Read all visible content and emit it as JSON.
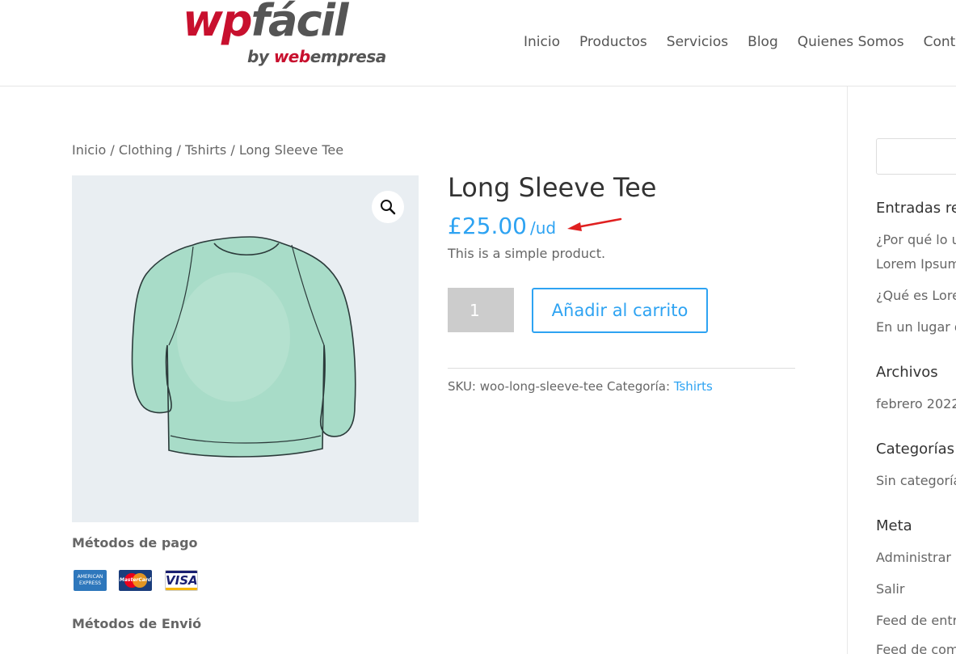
{
  "header": {
    "logo": {
      "main_red": "wp",
      "main_gray": "fácil",
      "by": "by ",
      "web": "web",
      "empresa": "empresa"
    },
    "nav": [
      "Inicio",
      "Productos",
      "Servicios",
      "Blog",
      "Quienes Somos",
      "Contacto"
    ]
  },
  "breadcrumb": {
    "items": [
      "Inicio",
      "Clothing",
      "Tshirts"
    ],
    "separator": " / ",
    "current": "Long Sleeve Tee"
  },
  "product": {
    "title": "Long Sleeve Tee",
    "price": "£25.00",
    "unit": "/ud",
    "short_description": "This is a simple product.",
    "quantity": "1",
    "add_to_cart_label": "Añadir al carrito",
    "sku_label": "SKU:",
    "sku": "woo-long-sleeve-tee",
    "category_label": "Categoría:",
    "category": "Tshirts",
    "image_icon": "long-sleeve-tee-image",
    "zoom_icon": "magnifier-icon"
  },
  "payment": {
    "heading": "Métodos de pago",
    "cards": [
      {
        "name": "amex",
        "line1": "AMERICAN",
        "line2": "EXPRESS"
      },
      {
        "name": "mastercard",
        "text": "MasterCard"
      },
      {
        "name": "visa",
        "text": "VISA"
      }
    ]
  },
  "shipping": {
    "heading": "Métodos de Envió"
  },
  "sidebar": {
    "recent_title": "Entradas recientes",
    "recent_posts": [
      "¿Por qué lo usamos?",
      "Lorem Ipsum",
      "¿Qué es Lorem Ipsum?",
      "En un lugar de la Mancha"
    ],
    "archives_title": "Archivos",
    "archives": [
      "febrero 2022"
    ],
    "categories_title": "Categorías",
    "categories": [
      "Sin categoría"
    ],
    "meta_title": "Meta",
    "meta_links": [
      "Administrar",
      "Salir",
      "Feed de entradas",
      "Feed de comentarios"
    ]
  },
  "colors": {
    "accent": "#2ea3f2",
    "logo_red": "#c8102e",
    "annotation_arrow": "#e02020",
    "shirt": "#a8dcc8"
  }
}
